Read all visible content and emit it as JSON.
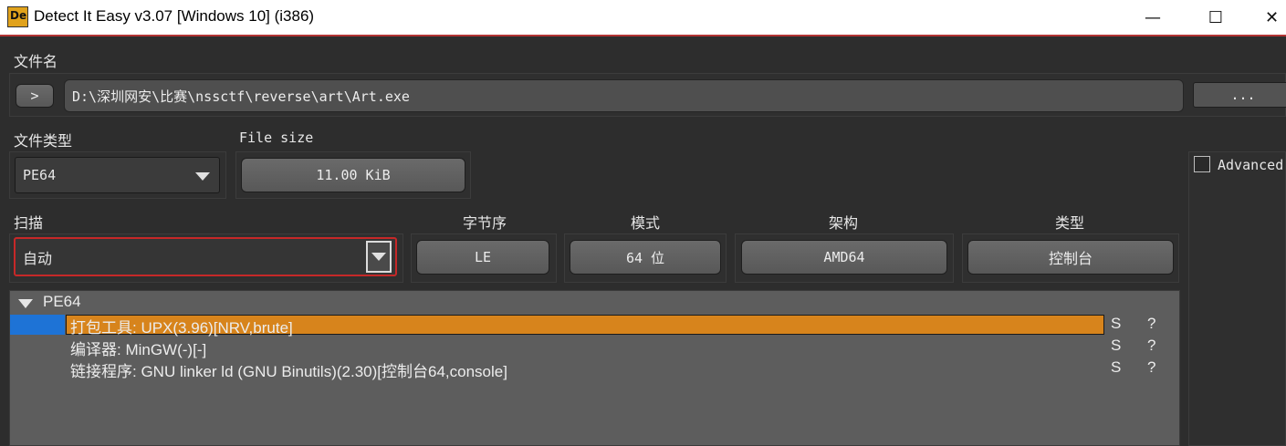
{
  "window": {
    "title": "Detect It Easy v3.07 [Windows 10] (i386)",
    "icon_text": "De",
    "minimize_glyph": "—",
    "maximize_glyph": "☐",
    "close_glyph": "✕"
  },
  "file": {
    "label": "文件名",
    "expand_glyph": ">",
    "path": "D:\\深圳网安\\比赛\\nssctf\\reverse\\art\\Art.exe",
    "browse_label": "..."
  },
  "file_type": {
    "label": "文件类型",
    "value": "PE64"
  },
  "file_size": {
    "label": "File size",
    "value": "11.00 KiB"
  },
  "advanced": {
    "label": "Advanced",
    "checked": false
  },
  "scan": {
    "label": "扫描",
    "value": "自动"
  },
  "info": {
    "endianness_label": "字节序",
    "endianness_value": "LE",
    "mode_label": "模式",
    "mode_value": "64 位",
    "arch_label": "架构",
    "arch_value": "AMD64",
    "type_label": "类型",
    "type_value": "控制台"
  },
  "results": {
    "root": "PE64",
    "items": [
      {
        "text": "打包工具: UPX(3.96)[NRV,brute]",
        "s": "S",
        "q": "?",
        "selected": true
      },
      {
        "text": "编译器: MinGW(-)[-]",
        "s": "S",
        "q": "?",
        "selected": false
      },
      {
        "text": "链接程序: GNU linker ld (GNU Binutils)(2.30)[控制台64,console]",
        "s": "S",
        "q": "?",
        "selected": false
      }
    ]
  },
  "colors": {
    "selection": "#d7841c",
    "selection_marker": "#1e73d6",
    "scan_border": "#c62828",
    "title_accent": "#b33434"
  }
}
